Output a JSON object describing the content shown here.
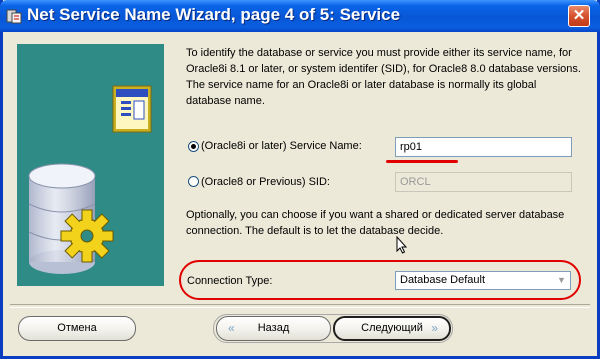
{
  "window": {
    "title": "Net Service Name Wizard, page 4 of 5: Service",
    "close_glyph": "✕"
  },
  "description": "To identify the database or service you must provide either its service name, for Oracle8i 8.1 or later, or system identifer (SID), for Oracle8 8.0 database versions. The service name for an Oracle8i or later database is normally its global database name.",
  "service_name": {
    "label": "(Oracle8i or later)  Service Name:",
    "value": "rp01",
    "selected": true
  },
  "sid": {
    "label": "(Oracle8 or Previous) SID:",
    "value": "ORCL",
    "selected": false
  },
  "optional_text": "Optionally, you can choose if you want a shared or dedicated server database connection. The default is to let the database decide.",
  "connection_type": {
    "label": "Connection Type:",
    "value": "Database Default"
  },
  "buttons": {
    "cancel": "Отмена",
    "back": "Назад",
    "next": "Следующий"
  },
  "colors": {
    "title_bar": "#0a5fe0",
    "illustration_bg": "#2e8b86",
    "annotation": "#e00000"
  }
}
